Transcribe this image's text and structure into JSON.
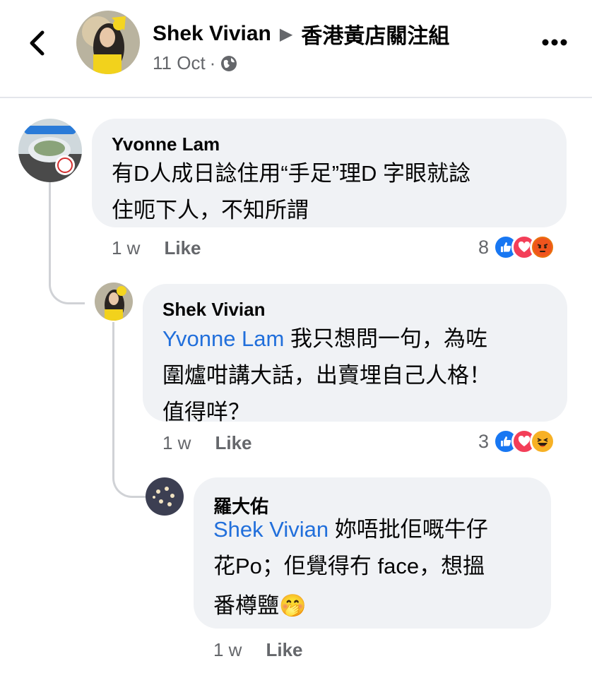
{
  "header": {
    "author": "Shek Vivian",
    "arrow": "▶",
    "group": "香港黃店關注組",
    "date": "11 Oct",
    "separator": "·"
  },
  "comments": [
    {
      "author": "Yvonne Lam",
      "text_line1": "有D人成日諗住用“手足”理D 字眼就諗",
      "text_line2": "住呃下人，不知所謂",
      "time": "1 w",
      "like_label": "Like",
      "reaction_count": "8",
      "reactions": [
        "like",
        "love",
        "angry"
      ]
    },
    {
      "author": "Shek Vivian",
      "mention": "Yvonne Lam",
      "text_line1": " 我只想問一句，為咗",
      "text_line2": "圍爐咁講大話，出賣埋自己人格！",
      "text_line3": "值得咩？",
      "time": "1 w",
      "like_label": "Like",
      "reaction_count": "3",
      "reactions": [
        "like",
        "love",
        "haha"
      ]
    },
    {
      "author": "羅大佑",
      "mention": "Shek Vivian",
      "text_line1": " 妳唔批佢嘅牛仔",
      "text_line2": "花Po；佢覺得冇 face，想搵",
      "text_line3": "番樽鹽",
      "emoji": "🤭",
      "time": "1 w",
      "like_label": "Like"
    }
  ],
  "colors": {
    "bubble": "#f0f2f5",
    "mention": "#216fdb",
    "like_reaction": "#1877f2",
    "love_reaction": "#f33e58",
    "angry_reaction": "#e9710f",
    "haha_reaction": "#f7b125"
  }
}
